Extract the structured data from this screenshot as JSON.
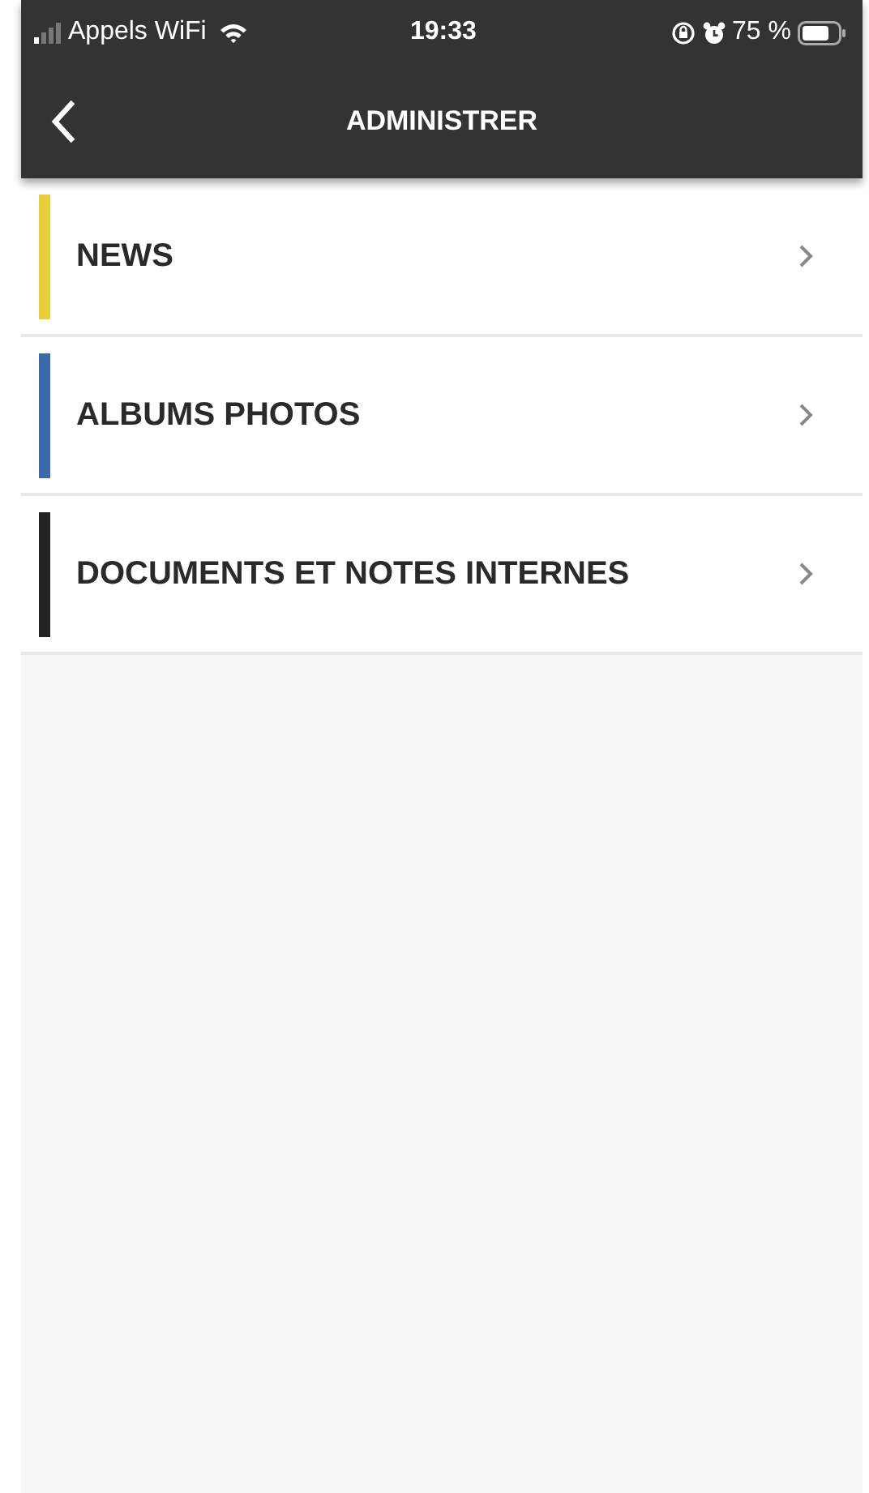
{
  "status_bar": {
    "carrier": "Appels WiFi",
    "time": "19:33",
    "battery": "75 %"
  },
  "header": {
    "title": "ADMINISTRER"
  },
  "menu": [
    {
      "label": "NEWS",
      "color": "#e8cf3a"
    },
    {
      "label": "ALBUMS PHOTOS",
      "color": "#3a6aa8"
    },
    {
      "label": "DOCUMENTS ET NOTES INTERNES",
      "color": "#222222"
    }
  ]
}
